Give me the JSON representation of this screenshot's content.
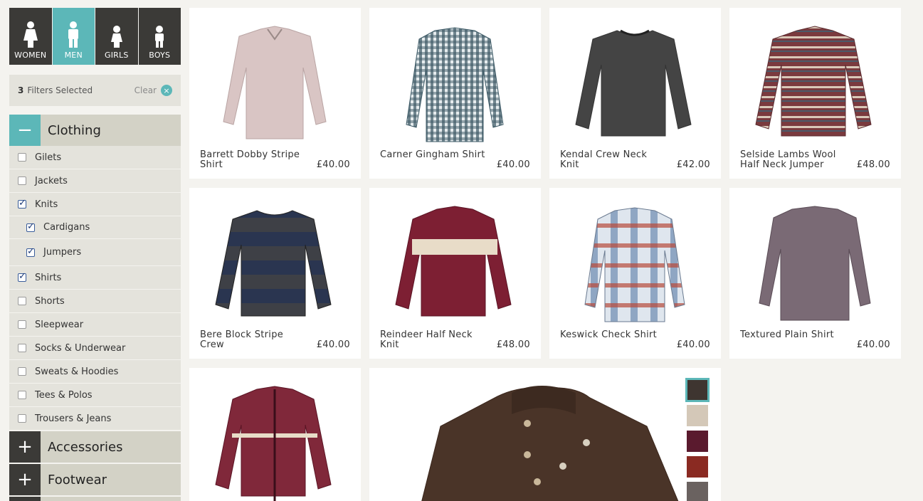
{
  "gender_tabs": [
    {
      "label": "WOMEN",
      "active": false
    },
    {
      "label": "MEN",
      "active": true
    },
    {
      "label": "GIRLS",
      "active": false
    },
    {
      "label": "BOYS",
      "active": false
    }
  ],
  "filters": {
    "count": "3",
    "label": "Filters Selected",
    "clear": "Clear",
    "clear_icon": "×"
  },
  "categories": {
    "clothing": {
      "toggle": "−",
      "label": "Clothing"
    },
    "accessories": {
      "toggle": "+",
      "label": "Accessories"
    },
    "footwear": {
      "toggle": "+",
      "label": "Footwear"
    }
  },
  "clothing_items": [
    {
      "label": "Gilets",
      "checked": false
    },
    {
      "label": "Jackets",
      "checked": false
    },
    {
      "label": "Knits",
      "checked": true
    },
    {
      "label": "Cardigans",
      "checked": true
    },
    {
      "label": "Jumpers",
      "checked": true
    },
    {
      "label": "Shirts",
      "checked": true
    },
    {
      "label": "Shorts",
      "checked": false
    },
    {
      "label": "Sleepwear",
      "checked": false
    },
    {
      "label": "Socks & Underwear",
      "checked": false
    },
    {
      "label": "Sweats & Hoodies",
      "checked": false
    },
    {
      "label": "Tees & Polos",
      "checked": false
    },
    {
      "label": "Trousers & Jeans",
      "checked": false
    }
  ],
  "products": [
    {
      "name": "Barrett Dobby Stripe Shirt",
      "price": "£40.00",
      "color": "#d9c5c4"
    },
    {
      "name": "Carner Gingham Shirt",
      "price": "£40.00",
      "color": "#3d5a66"
    },
    {
      "name": "Kendal Crew Neck Knit",
      "price": "£42.00",
      "color": "#444444"
    },
    {
      "name": "Selside Lambs Wool Half Neck Jumper",
      "price": "£48.00",
      "color": "#7a3a3e"
    },
    {
      "name": "Bere Block Stripe Crew",
      "price": "£40.00",
      "color": "#2a3550"
    },
    {
      "name": "Reindeer Half Neck Knit",
      "price": "£48.00",
      "color": "#7d1f33"
    },
    {
      "name": "Keswick Check Shirt",
      "price": "£40.00",
      "color": "#7b96b8"
    },
    {
      "name": "Textured Plain Shirt",
      "price": "£40.00",
      "color": "#7a6a75"
    },
    {
      "name": "",
      "price": "",
      "color": "#80283a"
    }
  ],
  "featured": {
    "color": "#4a3428",
    "swatches": [
      "#3e3530",
      "#d4c8b8",
      "#5a1a2e",
      "#8a2a22",
      "#6a6260"
    ]
  }
}
